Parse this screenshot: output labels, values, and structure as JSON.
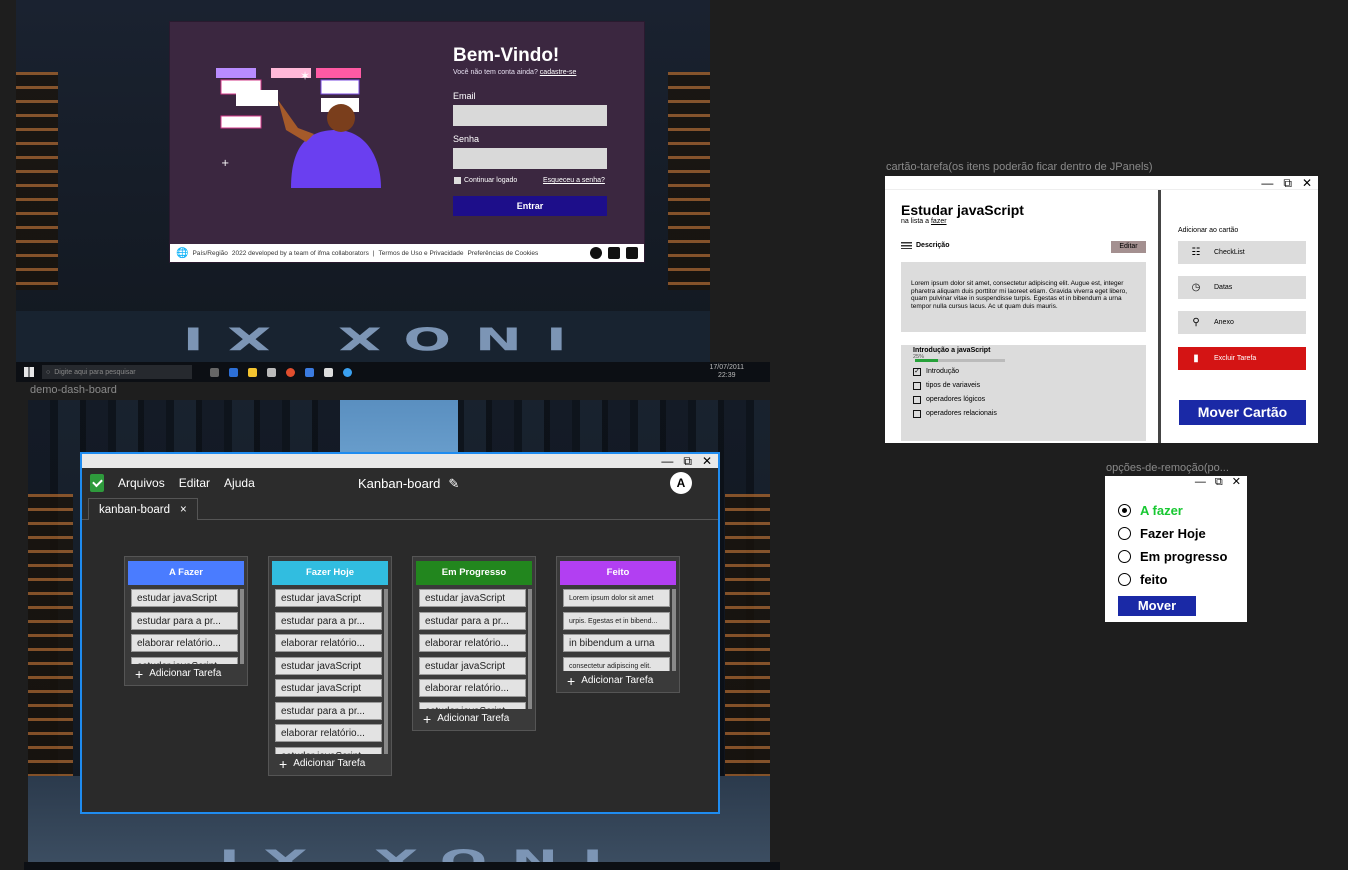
{
  "login": {
    "welcome": "Bem-Vindo!",
    "no_account": "Você não tem conta ainda?",
    "signup_link": "cadastre-se",
    "email_label": "Email",
    "password_label": "Senha",
    "keep_logged": "Continuar logado",
    "forgot": "Esqueceu a senha?",
    "enter_button": "Entrar",
    "footer": {
      "region": "País/Região",
      "credits": "2022 developed by a team of ifma collaborators",
      "separator": "|",
      "terms": "Termos de Uso e Privacidade",
      "cookies": "Preferências de Cookies"
    },
    "road_text": "INOX XI"
  },
  "taskbar": {
    "search_placeholder": "Digite aqui para pesquisar",
    "date": "17/07/2011",
    "time": "22:39"
  },
  "frames": {
    "dashboard_label": "demo-dash-board",
    "task_label": "cartão-tarefa(os itens poderão ficar dentro de JPanels)",
    "remove_label": "opções-de-remoção(po..."
  },
  "window_controls": {
    "minimize": "—",
    "restore": "⧉",
    "close": "✕"
  },
  "kanban": {
    "menu": [
      "Arquivos",
      "Editar",
      "Ajuda"
    ],
    "title": "Kanban-board",
    "edit_icon": "✎",
    "avatar": "A",
    "tab": "kanban-board",
    "tab_close": "×",
    "add_task": "Adicionar Tarefa",
    "columns": [
      {
        "name": "A Fazer",
        "color": "#4a7cff",
        "cards": [
          "estudar javaScript",
          "estudar para a pr...",
          "elaborar relatório...",
          "estudar javaScript"
        ]
      },
      {
        "name": "Fazer Hoje",
        "color": "#31bde0",
        "cards": [
          "estudar javaScript",
          "estudar para a pr...",
          "elaborar relatório...",
          "estudar javaScript",
          "estudar javaScript",
          "estudar para a pr...",
          "elaborar relatório...",
          "estudar javaScript"
        ]
      },
      {
        "name": "Em Progresso",
        "color": "#22861e",
        "cards": [
          "estudar javaScript",
          "estudar para a pr...",
          "elaborar relatório...",
          "estudar javaScript",
          "elaborar relatório...",
          "estudar javaScript"
        ]
      },
      {
        "name": "Feito",
        "color": "#b23ff2",
        "cards": [
          "Lorem ipsum dolor sit amet",
          "urpis. Egestas et in bibend...",
          "in bibendum a urna",
          "consectetur adipiscing elit."
        ]
      }
    ]
  },
  "task_card": {
    "title": "Estudar javaScript",
    "in_list": "na lista a",
    "list_name": "fazer",
    "description_label": "Descrição",
    "edit_button": "Editar",
    "description": "Lorem ipsum dolor sit amet, consectetur adipiscing elit. Augue est, integer pharetra aliquam duis porttitor mi laoreet etiam. Gravida viverra eget libero, quam pulvinar vitae in suspendisse turpis. Egestas et in bibendum a urna tempor nulla cursus lacus. Ac ut quam duis mauris.",
    "checklist_title": "Introdução a javaScript",
    "progress": 0.25,
    "progress_label": "25%",
    "checklist": [
      {
        "label": "Introdução",
        "checked": true
      },
      {
        "label": "tipos de variaveis",
        "checked": false
      },
      {
        "label": "operadores lógicos",
        "checked": false
      },
      {
        "label": "operadores relacionais",
        "checked": false
      }
    ],
    "add_to_card": "Adicionar ao cartão",
    "options": [
      {
        "label": "CheckList",
        "icon": "checklist-icon"
      },
      {
        "label": "Datas",
        "icon": "clock-icon"
      },
      {
        "label": "Anexo",
        "icon": "paperclip-icon"
      },
      {
        "label": "Excluir Tarefa",
        "icon": "trash-icon"
      }
    ],
    "move_button": "Mover Cartão"
  },
  "remove_options": {
    "options": [
      {
        "label": "A fazer",
        "selected": true,
        "color": "#18c832"
      },
      {
        "label": "Fazer Hoje",
        "selected": false
      },
      {
        "label": "Em progresso",
        "selected": false
      },
      {
        "label": "feito",
        "selected": false
      }
    ],
    "move_button": "Mover"
  }
}
